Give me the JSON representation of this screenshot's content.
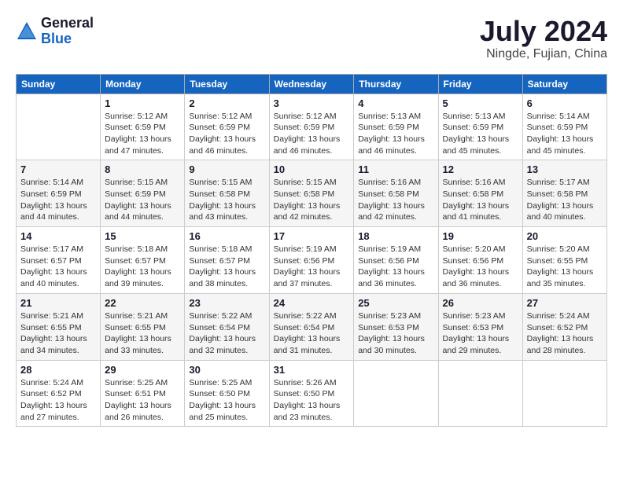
{
  "header": {
    "logo_general": "General",
    "logo_blue": "Blue",
    "month_year": "July 2024",
    "location": "Ningde, Fujian, China"
  },
  "days_of_week": [
    "Sunday",
    "Monday",
    "Tuesday",
    "Wednesday",
    "Thursday",
    "Friday",
    "Saturday"
  ],
  "weeks": [
    [
      {
        "day": null
      },
      {
        "day": "1",
        "sunrise": "Sunrise: 5:12 AM",
        "sunset": "Sunset: 6:59 PM",
        "daylight": "Daylight: 13 hours and 47 minutes."
      },
      {
        "day": "2",
        "sunrise": "Sunrise: 5:12 AM",
        "sunset": "Sunset: 6:59 PM",
        "daylight": "Daylight: 13 hours and 46 minutes."
      },
      {
        "day": "3",
        "sunrise": "Sunrise: 5:12 AM",
        "sunset": "Sunset: 6:59 PM",
        "daylight": "Daylight: 13 hours and 46 minutes."
      },
      {
        "day": "4",
        "sunrise": "Sunrise: 5:13 AM",
        "sunset": "Sunset: 6:59 PM",
        "daylight": "Daylight: 13 hours and 46 minutes."
      },
      {
        "day": "5",
        "sunrise": "Sunrise: 5:13 AM",
        "sunset": "Sunset: 6:59 PM",
        "daylight": "Daylight: 13 hours and 45 minutes."
      },
      {
        "day": "6",
        "sunrise": "Sunrise: 5:14 AM",
        "sunset": "Sunset: 6:59 PM",
        "daylight": "Daylight: 13 hours and 45 minutes."
      }
    ],
    [
      {
        "day": "7",
        "sunrise": "Sunrise: 5:14 AM",
        "sunset": "Sunset: 6:59 PM",
        "daylight": "Daylight: 13 hours and 44 minutes."
      },
      {
        "day": "8",
        "sunrise": "Sunrise: 5:15 AM",
        "sunset": "Sunset: 6:59 PM",
        "daylight": "Daylight: 13 hours and 44 minutes."
      },
      {
        "day": "9",
        "sunrise": "Sunrise: 5:15 AM",
        "sunset": "Sunset: 6:58 PM",
        "daylight": "Daylight: 13 hours and 43 minutes."
      },
      {
        "day": "10",
        "sunrise": "Sunrise: 5:15 AM",
        "sunset": "Sunset: 6:58 PM",
        "daylight": "Daylight: 13 hours and 42 minutes."
      },
      {
        "day": "11",
        "sunrise": "Sunrise: 5:16 AM",
        "sunset": "Sunset: 6:58 PM",
        "daylight": "Daylight: 13 hours and 42 minutes."
      },
      {
        "day": "12",
        "sunrise": "Sunrise: 5:16 AM",
        "sunset": "Sunset: 6:58 PM",
        "daylight": "Daylight: 13 hours and 41 minutes."
      },
      {
        "day": "13",
        "sunrise": "Sunrise: 5:17 AM",
        "sunset": "Sunset: 6:58 PM",
        "daylight": "Daylight: 13 hours and 40 minutes."
      }
    ],
    [
      {
        "day": "14",
        "sunrise": "Sunrise: 5:17 AM",
        "sunset": "Sunset: 6:57 PM",
        "daylight": "Daylight: 13 hours and 40 minutes."
      },
      {
        "day": "15",
        "sunrise": "Sunrise: 5:18 AM",
        "sunset": "Sunset: 6:57 PM",
        "daylight": "Daylight: 13 hours and 39 minutes."
      },
      {
        "day": "16",
        "sunrise": "Sunrise: 5:18 AM",
        "sunset": "Sunset: 6:57 PM",
        "daylight": "Daylight: 13 hours and 38 minutes."
      },
      {
        "day": "17",
        "sunrise": "Sunrise: 5:19 AM",
        "sunset": "Sunset: 6:56 PM",
        "daylight": "Daylight: 13 hours and 37 minutes."
      },
      {
        "day": "18",
        "sunrise": "Sunrise: 5:19 AM",
        "sunset": "Sunset: 6:56 PM",
        "daylight": "Daylight: 13 hours and 36 minutes."
      },
      {
        "day": "19",
        "sunrise": "Sunrise: 5:20 AM",
        "sunset": "Sunset: 6:56 PM",
        "daylight": "Daylight: 13 hours and 36 minutes."
      },
      {
        "day": "20",
        "sunrise": "Sunrise: 5:20 AM",
        "sunset": "Sunset: 6:55 PM",
        "daylight": "Daylight: 13 hours and 35 minutes."
      }
    ],
    [
      {
        "day": "21",
        "sunrise": "Sunrise: 5:21 AM",
        "sunset": "Sunset: 6:55 PM",
        "daylight": "Daylight: 13 hours and 34 minutes."
      },
      {
        "day": "22",
        "sunrise": "Sunrise: 5:21 AM",
        "sunset": "Sunset: 6:55 PM",
        "daylight": "Daylight: 13 hours and 33 minutes."
      },
      {
        "day": "23",
        "sunrise": "Sunrise: 5:22 AM",
        "sunset": "Sunset: 6:54 PM",
        "daylight": "Daylight: 13 hours and 32 minutes."
      },
      {
        "day": "24",
        "sunrise": "Sunrise: 5:22 AM",
        "sunset": "Sunset: 6:54 PM",
        "daylight": "Daylight: 13 hours and 31 minutes."
      },
      {
        "day": "25",
        "sunrise": "Sunrise: 5:23 AM",
        "sunset": "Sunset: 6:53 PM",
        "daylight": "Daylight: 13 hours and 30 minutes."
      },
      {
        "day": "26",
        "sunrise": "Sunrise: 5:23 AM",
        "sunset": "Sunset: 6:53 PM",
        "daylight": "Daylight: 13 hours and 29 minutes."
      },
      {
        "day": "27",
        "sunrise": "Sunrise: 5:24 AM",
        "sunset": "Sunset: 6:52 PM",
        "daylight": "Daylight: 13 hours and 28 minutes."
      }
    ],
    [
      {
        "day": "28",
        "sunrise": "Sunrise: 5:24 AM",
        "sunset": "Sunset: 6:52 PM",
        "daylight": "Daylight: 13 hours and 27 minutes."
      },
      {
        "day": "29",
        "sunrise": "Sunrise: 5:25 AM",
        "sunset": "Sunset: 6:51 PM",
        "daylight": "Daylight: 13 hours and 26 minutes."
      },
      {
        "day": "30",
        "sunrise": "Sunrise: 5:25 AM",
        "sunset": "Sunset: 6:50 PM",
        "daylight": "Daylight: 13 hours and 25 minutes."
      },
      {
        "day": "31",
        "sunrise": "Sunrise: 5:26 AM",
        "sunset": "Sunset: 6:50 PM",
        "daylight": "Daylight: 13 hours and 23 minutes."
      },
      {
        "day": null
      },
      {
        "day": null
      },
      {
        "day": null
      }
    ]
  ]
}
